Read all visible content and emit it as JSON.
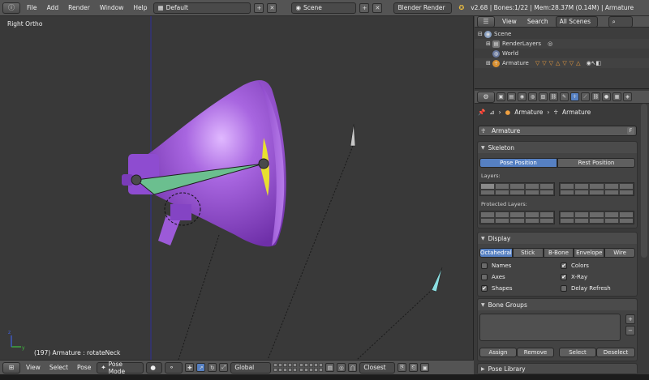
{
  "info_header": {
    "menus": [
      "File",
      "Add",
      "Render",
      "Window",
      "Help"
    ],
    "screen_layout": "Default",
    "scene": "Scene",
    "render_engine": "Blender Render",
    "stats": "v2.68 | Bones:1/22 | Mem:28.37M (0.14M) | Armature"
  },
  "viewport": {
    "view_label": "Right Ortho",
    "status_label": "(197) Armature : rotateNeck"
  },
  "viewport_header": {
    "menus": [
      "View",
      "Select",
      "Pose"
    ],
    "mode": "Pose Mode",
    "orientation": "Global",
    "snap_target": "Closest"
  },
  "outliner": {
    "header": {
      "view": "View",
      "search": "Search",
      "display": "All Scenes"
    },
    "rows": [
      "Scene",
      "RenderLayers",
      "World",
      "Armature"
    ]
  },
  "properties": {
    "breadcrumb": [
      "Armature",
      "Armature"
    ],
    "datablock_name": "Armature",
    "datablock_fake": "F",
    "skeleton": {
      "title": "Skeleton",
      "pose_position": "Pose Position",
      "rest_position": "Rest Position",
      "layers_label": "Layers:",
      "protected_label": "Protected Layers:"
    },
    "display": {
      "title": "Display",
      "modes": [
        "Octahedral",
        "Stick",
        "B-Bone",
        "Envelope",
        "Wire"
      ],
      "names": "Names",
      "axes": "Axes",
      "shapes": "Shapes",
      "colors": "Colors",
      "xray": "X-Ray",
      "delay_refresh": "Delay Refresh",
      "shapes_checked": true,
      "colors_checked": true,
      "xray_checked": true
    },
    "bone_groups": {
      "title": "Bone Groups",
      "assign": "Assign",
      "remove": "Remove",
      "select": "Select",
      "deselect": "Deselect"
    },
    "pose_library": {
      "title": "Pose Library"
    }
  },
  "colors": {
    "accent": "#5680c2",
    "lamp_body": "#9b59d6",
    "bone": "#6bbf8f",
    "axis_x": "#d04040",
    "axis_y": "#40c040",
    "axis_z": "#4060e0"
  }
}
